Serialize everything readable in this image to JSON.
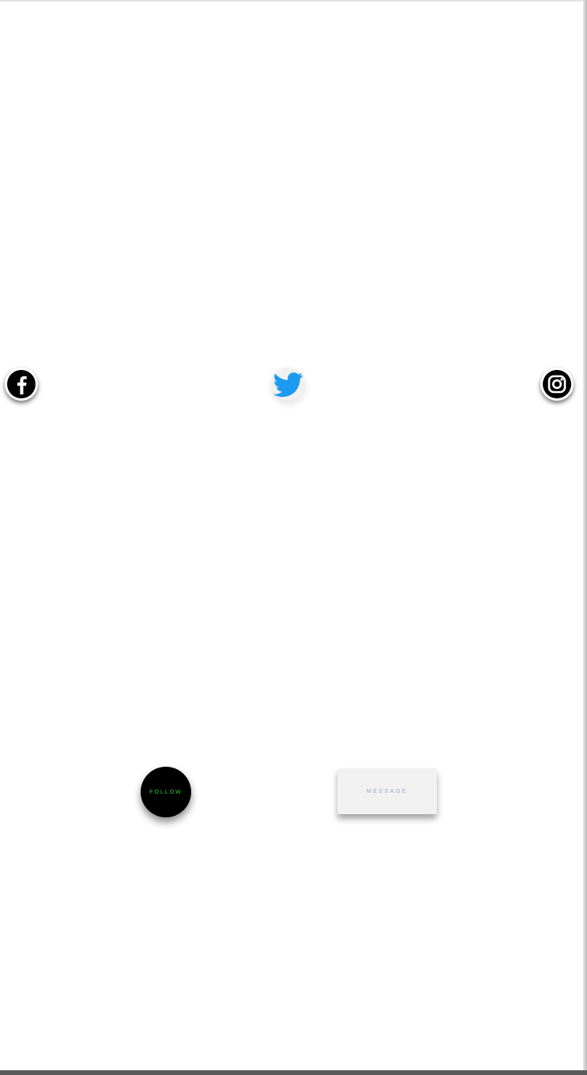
{
  "social": {
    "facebook": {
      "icon": "facebook-icon"
    },
    "twitter": {
      "icon": "twitter-icon",
      "color": "#1d9bf0"
    },
    "instagram": {
      "icon": "instagram-icon"
    }
  },
  "actions": {
    "follow_label": "FOLLOW",
    "follow_color": "#2fd62f",
    "message_label": "MESSAGE",
    "message_color": "#9aa0c8"
  }
}
